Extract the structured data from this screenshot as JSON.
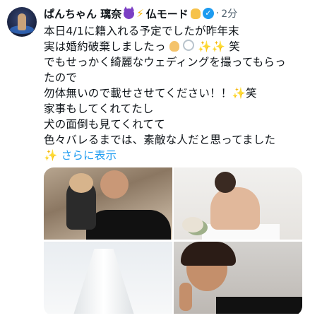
{
  "post": {
    "author_name": "ぱんちゃん 璃奈",
    "author_suffix": "仏モード",
    "dot": "·",
    "time": "2分",
    "lines": [
      "本日4/1に籍入れる予定でしたが昨年末",
      "実は婚約破棄しましたっ",
      "笑",
      "でもせっかく綺麗なウェディングを撮ってもらっ",
      "たので",
      "勿体無いので載せさせてください！！",
      "笑",
      "家事もしてくれてたし",
      "犬の面倒も見てくれてて",
      "色々バレるまでは、素敵な人だと思ってました"
    ],
    "show_more": "さらに表示",
    "verified_mark": "✓"
  },
  "icons": {
    "avatar": "avatar-photo",
    "devil": "smiling-devil-emoji",
    "bolt": "lightning-emoji",
    "ok": "ok-hand-emoji",
    "verified": "verified-badge-icon",
    "sparkle": "sparkles-emoji",
    "ring": "ring-emoji",
    "person": "person-emoji"
  },
  "colors": {
    "link": "#1d9bf0",
    "muted": "#536471",
    "text": "#0f1419"
  },
  "media": [
    {
      "subject": "bride-with-dog-photo"
    },
    {
      "subject": "bride-back-photo"
    },
    {
      "subject": "wedding-gown-photo"
    },
    {
      "subject": "bride-peace-sign-photo"
    }
  ]
}
